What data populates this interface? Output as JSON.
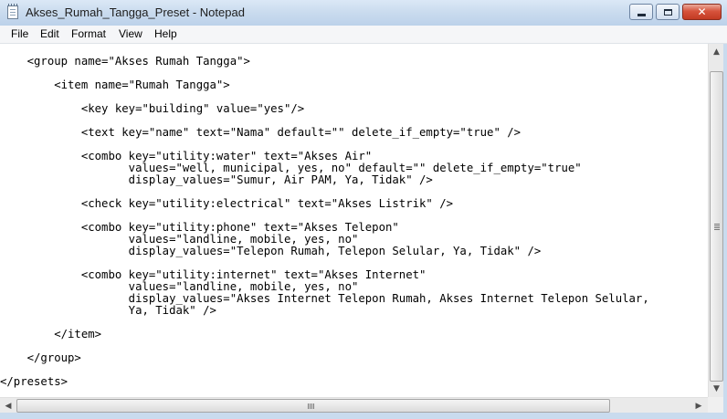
{
  "window": {
    "title": "Akses_Rumah_Tangga_Preset - Notepad",
    "close_glyph": "✕"
  },
  "menu": {
    "file": "File",
    "edit": "Edit",
    "format": "Format",
    "view": "View",
    "help": "Help"
  },
  "editor": {
    "content": "    <group name=\"Akses Rumah Tangga\">\n\n        <item name=\"Rumah Tangga\">\n\n            <key key=\"building\" value=\"yes\"/>\n\n            <text key=\"name\" text=\"Nama\" default=\"\" delete_if_empty=\"true\" />\n\n            <combo key=\"utility:water\" text=\"Akses Air\"\n                   values=\"well, municipal, yes, no\" default=\"\" delete_if_empty=\"true\"\n                   display_values=\"Sumur, Air PAM, Ya, Tidak\" />\n\n            <check key=\"utility:electrical\" text=\"Akses Listrik\" />\n\n            <combo key=\"utility:phone\" text=\"Akses Telepon\"\n                   values=\"landline, mobile, yes, no\"\n                   display_values=\"Telepon Rumah, Telepon Selular, Ya, Tidak\" />\n\n            <combo key=\"utility:internet\" text=\"Akses Internet\"\n                   values=\"landline, mobile, yes, no\"\n                   display_values=\"Akses Internet Telepon Rumah, Akses Internet Telepon Selular,\n                   Ya, Tidak\" />\n\n        </item>\n\n    </group>\n\n</presets>"
  },
  "scrollbars": {
    "up_arrow": "▲",
    "down_arrow": "▼",
    "left_arrow": "◀",
    "right_arrow": "▶"
  }
}
